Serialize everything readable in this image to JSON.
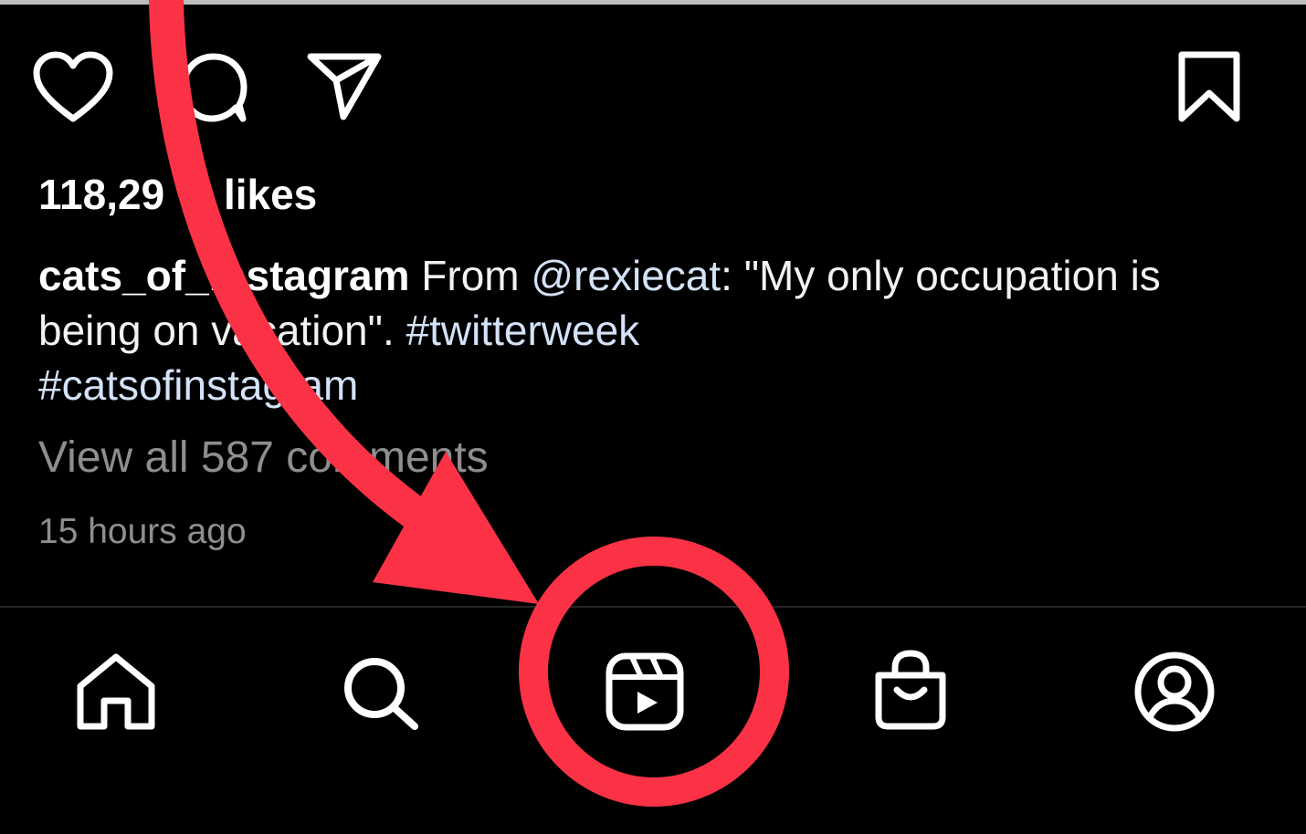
{
  "post": {
    "actions": {
      "like_icon": "heart-icon",
      "comment_icon": "comment-bubble-icon",
      "share_icon": "paper-plane-icon",
      "save_icon": "bookmark-icon"
    },
    "likes_text": "118,29",
    "likes_suffix": "likes",
    "caption": {
      "username": "cats_of_instagram",
      "text_part1": " From ",
      "mention": "@rexiecat",
      "text_part2": ": \"My only occupation is being on vacation\". ",
      "hashtag1": "#twitterweek",
      "hashtag2": "#catsofinstagram"
    },
    "view_comments": "View all 587 comments",
    "timestamp": "15 hours ago"
  },
  "tab_bar": {
    "items": [
      {
        "name": "home",
        "icon": "home-icon"
      },
      {
        "name": "search",
        "icon": "search-icon"
      },
      {
        "name": "reels",
        "icon": "reels-icon",
        "highlighted": true
      },
      {
        "name": "shop",
        "icon": "shopping-bag-icon"
      },
      {
        "name": "profile",
        "icon": "profile-icon"
      }
    ]
  },
  "annotation": {
    "color": "#fb3246",
    "type": "arrow-and-circle"
  },
  "colors": {
    "background": "#000000",
    "text": "#ffffff",
    "link": "#d4e2f8",
    "muted": "#8e8e8e"
  }
}
